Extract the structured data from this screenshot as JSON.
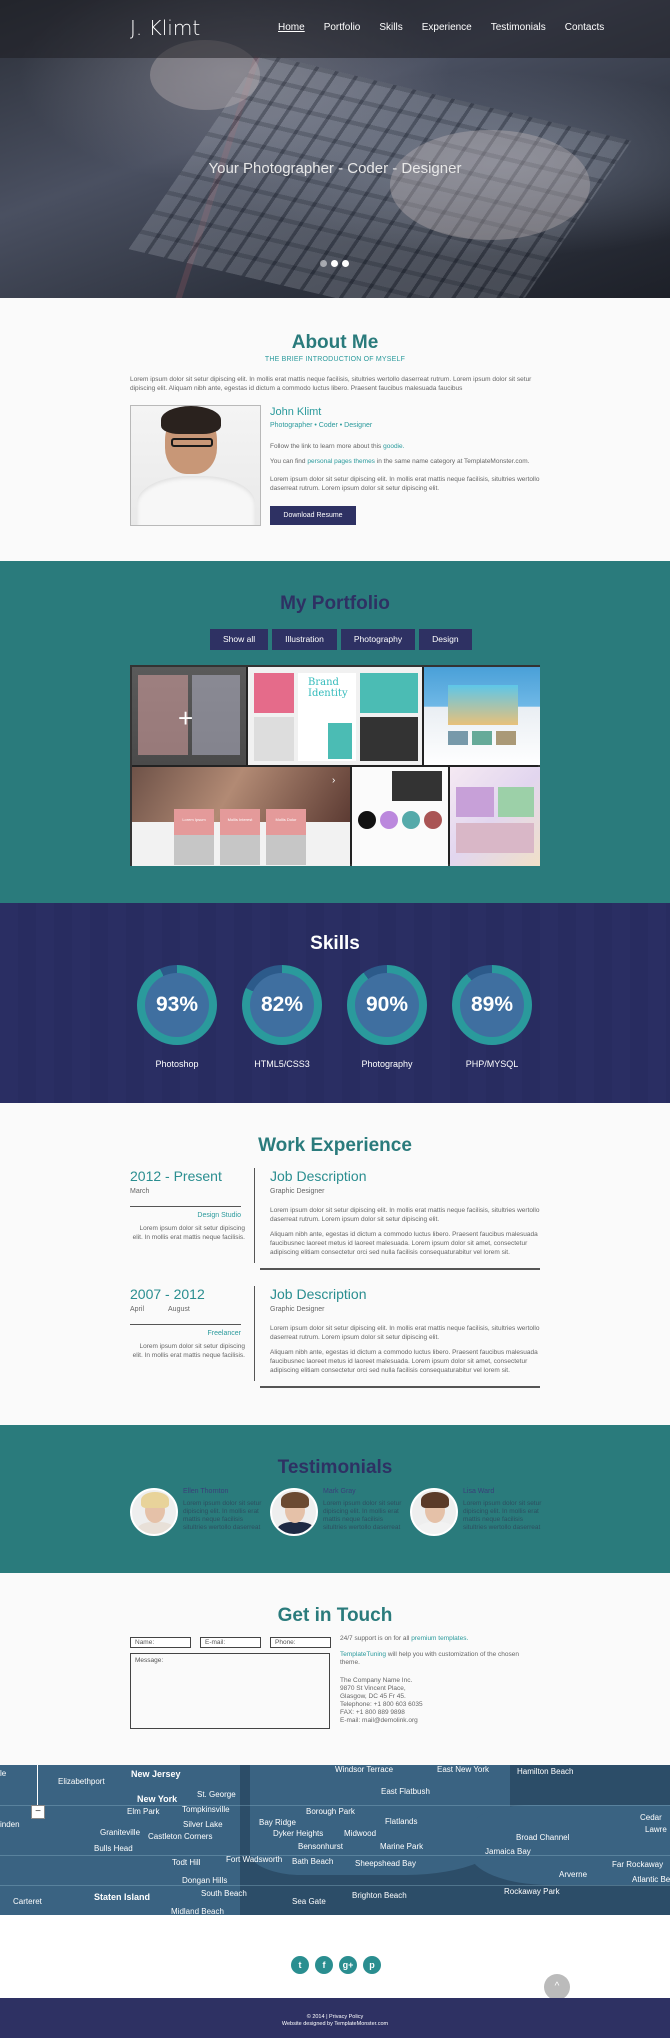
{
  "nav": {
    "logo": "J. Klimt",
    "items": [
      "Home",
      "Portfolio",
      "Skills",
      "Experience",
      "Testimonials",
      "Contacts"
    ]
  },
  "hero": {
    "tagline": "Your Photographer - Coder - Designer"
  },
  "about": {
    "title": "About Me",
    "subtitle": "THE BRIEF INTRODUCTION OF MYSELF",
    "intro": "Lorem ipsum dolor sit setur dipiscing elit. In mollis erat mattis neque facilisis, situltries wertollo daserreat rutrum. Lorem ipsum dolor sit setur dipiscing elit.  Aliquam nibh ante, egestas id dictum a commodo luctus libero. Praesent faucibus malesuada faucibus",
    "name": "John Klimt",
    "role": "Photographer • Coder • Designer",
    "follow_prefix": "Follow the link to learn more about this ",
    "follow_link": "goodie.",
    "find_prefix": "You can find ",
    "find_link": "personal pages themes",
    "find_suffix": " in the same name category at TemplateMonster.com.",
    "lorem": "Lorem ipsum dolor sit setur dipiscing elit. In mollis erat mattis neque facilisis, situltries wertollo daserreat rutrum. Lorem ipsum dolor sit setur dipiscing elit.",
    "button": "Download Resume"
  },
  "portfolio": {
    "title": "My Portfolio",
    "filters": [
      "Show all",
      "Illustration",
      "Photography",
      "Design"
    ],
    "brand_text": "Brand Identity",
    "cards": [
      "Lorem Ipsum",
      "Mollis Interest",
      "Mollis Dolor"
    ]
  },
  "skills": {
    "title": "Skills",
    "items": [
      {
        "label": "Photoshop",
        "value": "93%",
        "pct": 93
      },
      {
        "label": "HTML5/CSS3",
        "value": "82%",
        "pct": 82
      },
      {
        "label": "Photography",
        "value": "90%",
        "pct": 90
      },
      {
        "label": "PHP/MYSQL",
        "value": "89%",
        "pct": 89
      }
    ]
  },
  "work": {
    "title": "Work Experience",
    "jobs": [
      {
        "period": "2012 - Present",
        "month_start": "March",
        "month_end": "",
        "company": "Design Studio",
        "left_desc": "Lorem ipsum dolor sit setur dipiscing elit. In mollis erat mattis neque facilisis.",
        "heading": "Job Description",
        "position": "Graphic Designer",
        "p1": "Lorem ipsum dolor sit setur dipiscing elit. In mollis erat mattis neque facilisis, situltries wertollo daserreat rutrum. Lorem ipsum dolor sit setur dipiscing elit.",
        "p2": "Aliquam nibh ante, egestas id dictum a commodo luctus libero. Praesent faucibus malesuada faucibusnec laoreet metus id laoreet malesuada. Lorem ipsum dolor sit amet, consectetur adipiscing elitiam consectetur orci sed nulla facilisis consequaturabitur vel lorem sit."
      },
      {
        "period": "2007 - 2012",
        "month_start": "April",
        "month_end": "August",
        "company": "Freelancer",
        "left_desc": "Lorem ipsum dolor sit setur dipiscing elit. In mollis erat mattis neque facilisis.",
        "heading": "Job Description",
        "position": "Graphic Designer",
        "p1": "Lorem ipsum dolor sit setur dipiscing elit. In mollis erat mattis neque facilisis, situltries wertollo daserreat rutrum. Lorem ipsum dolor sit setur dipiscing elit.",
        "p2": "Aliquam nibh ante, egestas id dictum a commodo luctus libero. Praesent faucibus malesuada faucibusnec laoreet metus id laoreet malesuada. Lorem ipsum dolor sit amet, consectetur adipiscing elitiam consectetur orci sed nulla facilisis consequaturabitur vel lorem sit."
      }
    ]
  },
  "testimonials": {
    "title": "Testimonials",
    "items": [
      {
        "name": "Ellen Thornton",
        "text": "Lorem ipsum dolor sit setur dipiscing elit. In mollis erat mattis neque facilisis situltries wertollo daserreat"
      },
      {
        "name": "Mark Gray",
        "text": "Lorem ipsum dolor sit setur dipiscing elit. In mollis erat mattis neque facilisis situltries wertollo daserreat"
      },
      {
        "name": "Lisa Ward",
        "text": "Lorem ipsum dolor sit setur dipiscing elit. In mollis erat mattis neque facilisis situltries wertollo daserreat"
      }
    ]
  },
  "contact": {
    "title": "Get in Touch",
    "name_placeholder": "Name:",
    "email_placeholder": "E-mail:",
    "phone_placeholder": "Phone:",
    "message_placeholder": "Message:",
    "support_prefix": "24/7 support is on for all ",
    "support_link": "premium templates.",
    "tt_link": "TemplateTuning",
    "tt_suffix": " will help you with customization of the chosen theme.",
    "address": [
      "The Company Name Inc.",
      "9870 St Vincent Place,",
      "Glasgow, DC 45 Fr 45.",
      "Telephone: +1 800 603 6035",
      "FAX: +1 800 889 9898",
      "E-mail: mail@demolink.org"
    ]
  },
  "map": {
    "labels": [
      {
        "t": "Elizabethport",
        "b": false
      },
      {
        "t": "New Jersey",
        "b": true
      },
      {
        "t": "St. George",
        "b": false
      },
      {
        "t": "Windsor Terrace",
        "b": false
      },
      {
        "t": "East New York",
        "b": false
      },
      {
        "t": "Hamilton Beach",
        "b": false
      },
      {
        "t": "New York",
        "b": true
      },
      {
        "t": "Elm Park",
        "b": false
      },
      {
        "t": "Tompkinsville",
        "b": false
      },
      {
        "t": "East Flatbush",
        "b": false
      },
      {
        "t": "Borough Park",
        "b": false
      },
      {
        "t": "Silver Lake",
        "b": false
      },
      {
        "t": "Bay Ridge",
        "b": false
      },
      {
        "t": "Flatlands",
        "b": false
      },
      {
        "t": "Graniteville",
        "b": false
      },
      {
        "t": "Castleton Corners",
        "b": false
      },
      {
        "t": "Dyker Heights",
        "b": false
      },
      {
        "t": "Midwood",
        "b": false
      },
      {
        "t": "Bulls Head",
        "b": false
      },
      {
        "t": "Bensonhurst",
        "b": false
      },
      {
        "t": "Marine Park",
        "b": false
      },
      {
        "t": "Todt Hill",
        "b": false
      },
      {
        "t": "Fort Wadsworth",
        "b": false
      },
      {
        "t": "Bath Beach",
        "b": false
      },
      {
        "t": "Sheepshead Bay",
        "b": false
      },
      {
        "t": "Jamaica Bay",
        "b": false
      },
      {
        "t": "Broad Channel",
        "b": false
      },
      {
        "t": "Dongan Hills",
        "b": false
      },
      {
        "t": "Arverne",
        "b": false
      },
      {
        "t": "Far Rockaway",
        "b": false
      },
      {
        "t": "South Beach",
        "b": false
      },
      {
        "t": "Brighton Beach",
        "b": false
      },
      {
        "t": "Carteret",
        "b": false
      },
      {
        "t": "Staten Island",
        "b": true
      },
      {
        "t": "Sea Gate",
        "b": false
      },
      {
        "t": "Rockaway Park",
        "b": false
      },
      {
        "t": "Midland Beach",
        "b": false
      },
      {
        "t": "Atlantic Be",
        "b": false
      },
      {
        "t": "Cedar",
        "b": false
      },
      {
        "t": "Lawre",
        "b": false
      },
      {
        "t": "inden",
        "b": false
      },
      {
        "t": "le",
        "b": false
      }
    ],
    "zoom_out": "−"
  },
  "social": [
    "t",
    "f",
    "g+",
    "p"
  ],
  "footer": {
    "line1": "© 2014 | Privacy Policy",
    "line2": "Website designed by TemplateMonster.com"
  },
  "colors": {
    "teal": "#2a7b7c",
    "navy": "#2e3163",
    "accent": "#2a9a9c"
  }
}
